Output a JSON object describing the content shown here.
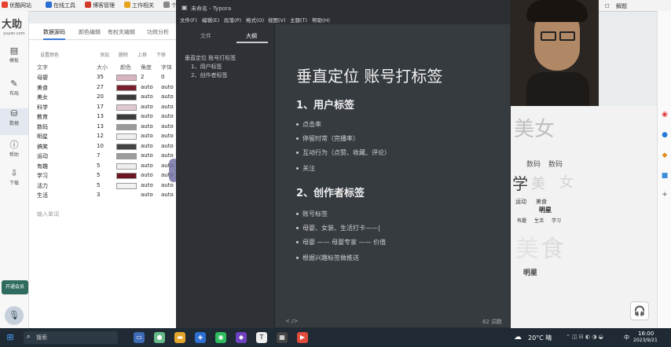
{
  "bookmarks": [
    {
      "label": "优酷网站",
      "color": "#e6422e"
    },
    {
      "label": "在线工具",
      "color": "#2a6fd1"
    },
    {
      "label": "博客管理",
      "color": "#d13b2a"
    },
    {
      "label": "工作相关",
      "color": "#e8a31e"
    },
    {
      "label": "个",
      "color": "#888888"
    }
  ],
  "browser_tab_right": "解题",
  "sidebar": {
    "logo": "大助",
    "logo_url": "yuyan.com",
    "items": [
      {
        "label": "模板",
        "icon": "layout-icon"
      },
      {
        "label": "布局",
        "icon": "wrench-icon"
      },
      {
        "label": "数据",
        "icon": "database-icon"
      },
      {
        "label": "帮助",
        "icon": "info-icon"
      },
      {
        "label": "下载",
        "icon": "download-icon"
      }
    ],
    "promo": "开通会员"
  },
  "data_panel": {
    "tabs": [
      "数据源码",
      "颜色编辑",
      "有权关编辑",
      "功效分析"
    ],
    "settings_label": "设置颜色",
    "col_headers": [
      "添加",
      "删除",
      "上移",
      "下移"
    ],
    "table_headers": {
      "word": "文字",
      "size": "大小",
      "color": "颜色",
      "angle": "角度",
      "font": "字体"
    },
    "rows": [
      {
        "word": "母婴",
        "size": "35",
        "color": "#d8b4c0",
        "angle": "2",
        "font": "0"
      },
      {
        "word": "美食",
        "size": "27",
        "color": "#7a1f2f",
        "angle": "auto",
        "font": "auto"
      },
      {
        "word": "美女",
        "size": "20",
        "color": "#3a3a3a",
        "angle": "auto",
        "font": "auto"
      },
      {
        "word": "科学",
        "size": "17",
        "color": "#e0c9d0",
        "angle": "auto",
        "font": "auto"
      },
      {
        "word": "教育",
        "size": "13",
        "color": "#3c3c3c",
        "angle": "auto",
        "font": "auto"
      },
      {
        "word": "数码",
        "size": "13",
        "color": "#9a9a9a",
        "angle": "auto",
        "font": "auto"
      },
      {
        "word": "明星",
        "size": "12",
        "color": "#f0f0f0",
        "angle": "auto",
        "font": "auto"
      },
      {
        "word": "搞笑",
        "size": "10",
        "color": "#444444",
        "angle": "auto",
        "font": "auto"
      },
      {
        "word": "运动",
        "size": "7",
        "color": "#9c9c9c",
        "angle": "auto",
        "font": "auto"
      },
      {
        "word": "有趣",
        "size": "5",
        "color": "#eeeeee",
        "angle": "auto",
        "font": "auto"
      },
      {
        "word": "学习",
        "size": "5",
        "color": "#6b1525",
        "angle": "auto",
        "font": "auto"
      },
      {
        "word": "活力",
        "size": "5",
        "color": "#f2f2f2",
        "angle": "auto",
        "font": "auto"
      },
      {
        "word": "生活",
        "size": "3",
        "color": "",
        "angle": "auto",
        "font": "auto"
      }
    ],
    "input_placeholder": "输入单词"
  },
  "typora": {
    "window_title": "未命名 - Typora",
    "menu": [
      "文件(F)",
      "编辑(E)",
      "段落(P)",
      "格式(O)",
      "视图(V)",
      "主题(T)",
      "帮助(H)"
    ],
    "side_tabs": [
      "文件",
      "大纲"
    ],
    "outline": [
      "垂直定位 账号打标签",
      "1、用户标签",
      "2、创作者标签"
    ],
    "doc": {
      "title": "垂直定位 账号打标签",
      "section1": "1、用户标签",
      "items1": [
        "点击率",
        "停留时常（完播率）",
        "互动行为（点赞、收藏、评论）",
        "关注"
      ],
      "section2": "2、创作者标签",
      "items2": [
        "账号标签",
        "母婴、女装、生活打卡——|",
        "母婴 —— 母婴专家 —— 价值",
        "根据兴趣标签做推送"
      ]
    },
    "status": {
      "left": "<  />",
      "right": "82 词数"
    }
  },
  "wordcloud": [
    "美女",
    "数码",
    "数码",
    "学",
    "美",
    "女",
    "运动",
    "美食",
    "明星",
    "有趣",
    "生活",
    "学习",
    "明星",
    "美",
    "食"
  ],
  "taskbar": {
    "search": "搜索",
    "weather": "20°C 晴",
    "time": "16:00",
    "date": "2023/9/21",
    "lang": "中"
  }
}
